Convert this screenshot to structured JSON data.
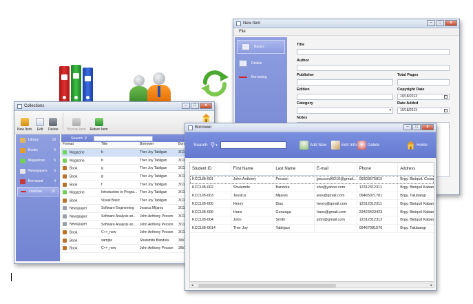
{
  "colors": {
    "side_panel": "#7a8bd8",
    "header_blue": "#6b7fd3",
    "selection": "#cfe0f7",
    "book_red": "#d42626",
    "book_green": "#35a83a",
    "book_blue": "#2f5cd0"
  },
  "new_item": {
    "title": "New Item",
    "menu": [
      "File"
    ],
    "side": [
      {
        "label": "Basics",
        "icon": "basics-icon"
      },
      {
        "label": "Details",
        "icon": "details-icon"
      },
      {
        "label": "Borrowing",
        "icon": "borrowing-icon"
      }
    ],
    "fields": {
      "title_label": "Title",
      "author_label": "Author",
      "publisher_label": "Publisher",
      "total_pages_label": "Total Pages",
      "edition_label": "Edition",
      "copyright_date_label": "Copyright Date",
      "copyright_date_value": "10/18/2013",
      "category_label": "Category",
      "date_added_label": "Date Added",
      "date_added_value": "10/18/2013",
      "notes_label": "Notes"
    }
  },
  "collections": {
    "title": "Collections",
    "toolbar": {
      "new_item": "New Item",
      "edit": "Edit",
      "delete": "Delete",
      "borrow_item": "Borrow Item",
      "return_item": "Return Item"
    },
    "side": [
      {
        "label": "Library",
        "count": "19"
      },
      {
        "label": "Books",
        "count": "5"
      },
      {
        "label": "Magazines",
        "count": "5"
      },
      {
        "label": "Newspapers",
        "count": "5"
      },
      {
        "label": "Borrowed",
        "count": "4"
      },
      {
        "label": "Overdue",
        "count": "10"
      }
    ],
    "search_label": "Search",
    "columns": [
      "Format",
      "Title",
      "Borrower",
      "Borro"
    ],
    "rows": [
      {
        "format": "Magazine",
        "title": "b",
        "borrower": "Ther Joy Tabligan",
        "date": "3/11/"
      },
      {
        "format": "Magazine",
        "title": "b",
        "borrower": "Ther Joy Tabligan",
        "date": "3/11/"
      },
      {
        "format": "Book",
        "title": "g",
        "borrower": "Ther Joy Tabligan",
        "date": "3/11/"
      },
      {
        "format": "Book",
        "title": "g",
        "borrower": "Ther Joy Tabligan",
        "date": "3/11/"
      },
      {
        "format": "Book",
        "title": "f",
        "borrower": "Ther Joy Tabligan",
        "date": "3/11/"
      },
      {
        "format": "Magazine",
        "title": "Introduction to Progra...",
        "borrower": "Ther Joy Tabligan",
        "date": "3/11/"
      },
      {
        "format": "Book",
        "title": "Visual Basic",
        "borrower": "Ther Joy Tabligan",
        "date": "3/11/"
      },
      {
        "format": "Newspaper",
        "title": "Software Engineering",
        "borrower": "Jessica Mijares",
        "date": "3/11/"
      },
      {
        "format": "Newspaper",
        "title": "Software Analysis an...",
        "borrower": "John Anthony Pecson",
        "date": "3/11/"
      },
      {
        "format": "Newspaper",
        "title": "Software Analysis an...",
        "borrower": "John Anthony Pecson",
        "date": "3/11/"
      },
      {
        "format": "Book",
        "title": "C++_new",
        "borrower": "John Anthony Pecson",
        "date": "3/11/"
      },
      {
        "format": "Book",
        "title": "sample",
        "borrower": "Shulamite Bandola",
        "date": "3/8/2"
      },
      {
        "format": "Book",
        "title": "C++_new",
        "borrower": "John Anthony Pecson",
        "date": "3/8/2"
      }
    ]
  },
  "borrower": {
    "title": "Borrower",
    "search_label": "Search",
    "actions": {
      "add_new": "Add New",
      "edit_info": "Edit Info",
      "delete": "Delete",
      "home": "Home"
    },
    "columns": [
      "Student ID",
      "First Name",
      "Last Name",
      "E-mail",
      "Phone",
      "Address"
    ],
    "rows": [
      {
        "id": "KCCLIB-001",
        "first": "John Anthony",
        "last": "Pecson",
        "email": "jpecson90210@gmail....",
        "phone": "09303575815",
        "address": "Brgy. Biniquil. Crossing"
      },
      {
        "id": "KCCLIB-002",
        "first": "Shulamite",
        "last": "Bandola",
        "email": "shu@yahoo.com",
        "phone": "12312312311",
        "address": "Brgy. Biniquil Kabanka..."
      },
      {
        "id": "KCCLIB-003",
        "first": "Jessica",
        "last": "Mijares",
        "email": "jess@gmail.com",
        "phone": "09465071781",
        "address": "Brgy. Talubangi"
      },
      {
        "id": "KCCLIB-005",
        "first": "Henry",
        "last": "Diaz",
        "email": "henry@gmail.com",
        "phone": "12312312311",
        "address": "Brgy. Biniquil Kabanka..."
      },
      {
        "id": "KCCLIB-006",
        "first": "Hans",
        "last": "Gonzaga",
        "email": "hans@gmail.com",
        "phone": "23423423423",
        "address": "Brgy. Biniquil Kabanka..."
      },
      {
        "id": "KCCLIB-004",
        "first": "John",
        "last": "Smith",
        "email": "john@gmail.com",
        "phone": "12312312312",
        "address": "Brgy. Biniquil Kabanka..."
      },
      {
        "id": "KCCLIB-0014",
        "first": "Ther Joy",
        "last": "Tabligan",
        "email": "",
        "phone": "09467081576",
        "address": "Brgy. Talubangi"
      }
    ]
  }
}
